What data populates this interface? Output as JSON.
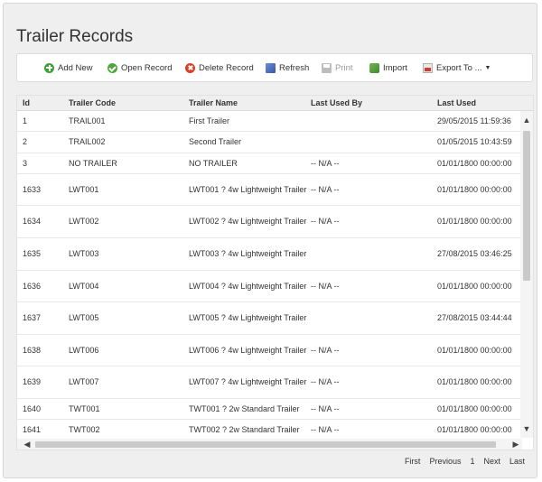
{
  "page": {
    "title": "Trailer Records"
  },
  "toolbar": {
    "add": "Add New",
    "open": "Open Record",
    "delete": "Delete Record",
    "refresh": "Refresh",
    "print": "Print",
    "import": "Import",
    "export": "Export To ..."
  },
  "grid": {
    "columns": [
      "Id",
      "Trailer Code",
      "Trailer Name",
      "Last Used By",
      "Last Used"
    ],
    "rows": [
      {
        "id": "1",
        "code": "TRAIL001",
        "name": "First Trailer",
        "by": "",
        "used": "29/05/2015 11:59:36"
      },
      {
        "id": "2",
        "code": "TRAIL002",
        "name": "Second Trailer",
        "by": "",
        "used": "01/05/2015 10:43:59"
      },
      {
        "id": "3",
        "code": "NO TRAILER",
        "name": "NO TRAILER",
        "by": "-- N/A --",
        "used": "01/01/1800 00:00:00"
      },
      {
        "id": "1633",
        "code": "LWT001",
        "name": "LWT001 ? 4w Lightweight Trailer",
        "by": "-- N/A --",
        "used": "01/01/1800 00:00:00"
      },
      {
        "id": "1634",
        "code": "LWT002",
        "name": "LWT002 ? 4w Lightweight Trailer",
        "by": "-- N/A --",
        "used": "01/01/1800 00:00:00"
      },
      {
        "id": "1635",
        "code": "LWT003",
        "name": "LWT003 ? 4w Lightweight Trailer",
        "by": "",
        "used": "27/08/2015 03:46:25"
      },
      {
        "id": "1636",
        "code": "LWT004",
        "name": "LWT004 ? 4w Lightweight Trailer",
        "by": "-- N/A --",
        "used": "01/01/1800 00:00:00"
      },
      {
        "id": "1637",
        "code": "LWT005",
        "name": "LWT005 ? 4w Lightweight Trailer",
        "by": "",
        "used": "27/08/2015 03:44:44"
      },
      {
        "id": "1638",
        "code": "LWT006",
        "name": "LWT006 ? 4w Lightweight Trailer",
        "by": "-- N/A --",
        "used": "01/01/1800 00:00:00"
      },
      {
        "id": "1639",
        "code": "LWT007",
        "name": "LWT007 ? 4w Lightweight Trailer",
        "by": "-- N/A --",
        "used": "01/01/1800 00:00:00"
      },
      {
        "id": "1640",
        "code": "TWT001",
        "name": "TWT001 ? 2w Standard Trailer",
        "by": "-- N/A --",
        "used": "01/01/1800 00:00:00"
      },
      {
        "id": "1641",
        "code": "TWT002",
        "name": "TWT002 ? 2w Standard Trailer",
        "by": "-- N/A --",
        "used": "01/01/1800 00:00:00"
      }
    ]
  },
  "pager": {
    "first": "First",
    "previous": "Previous",
    "page": "1",
    "next": "Next",
    "last": "Last"
  }
}
